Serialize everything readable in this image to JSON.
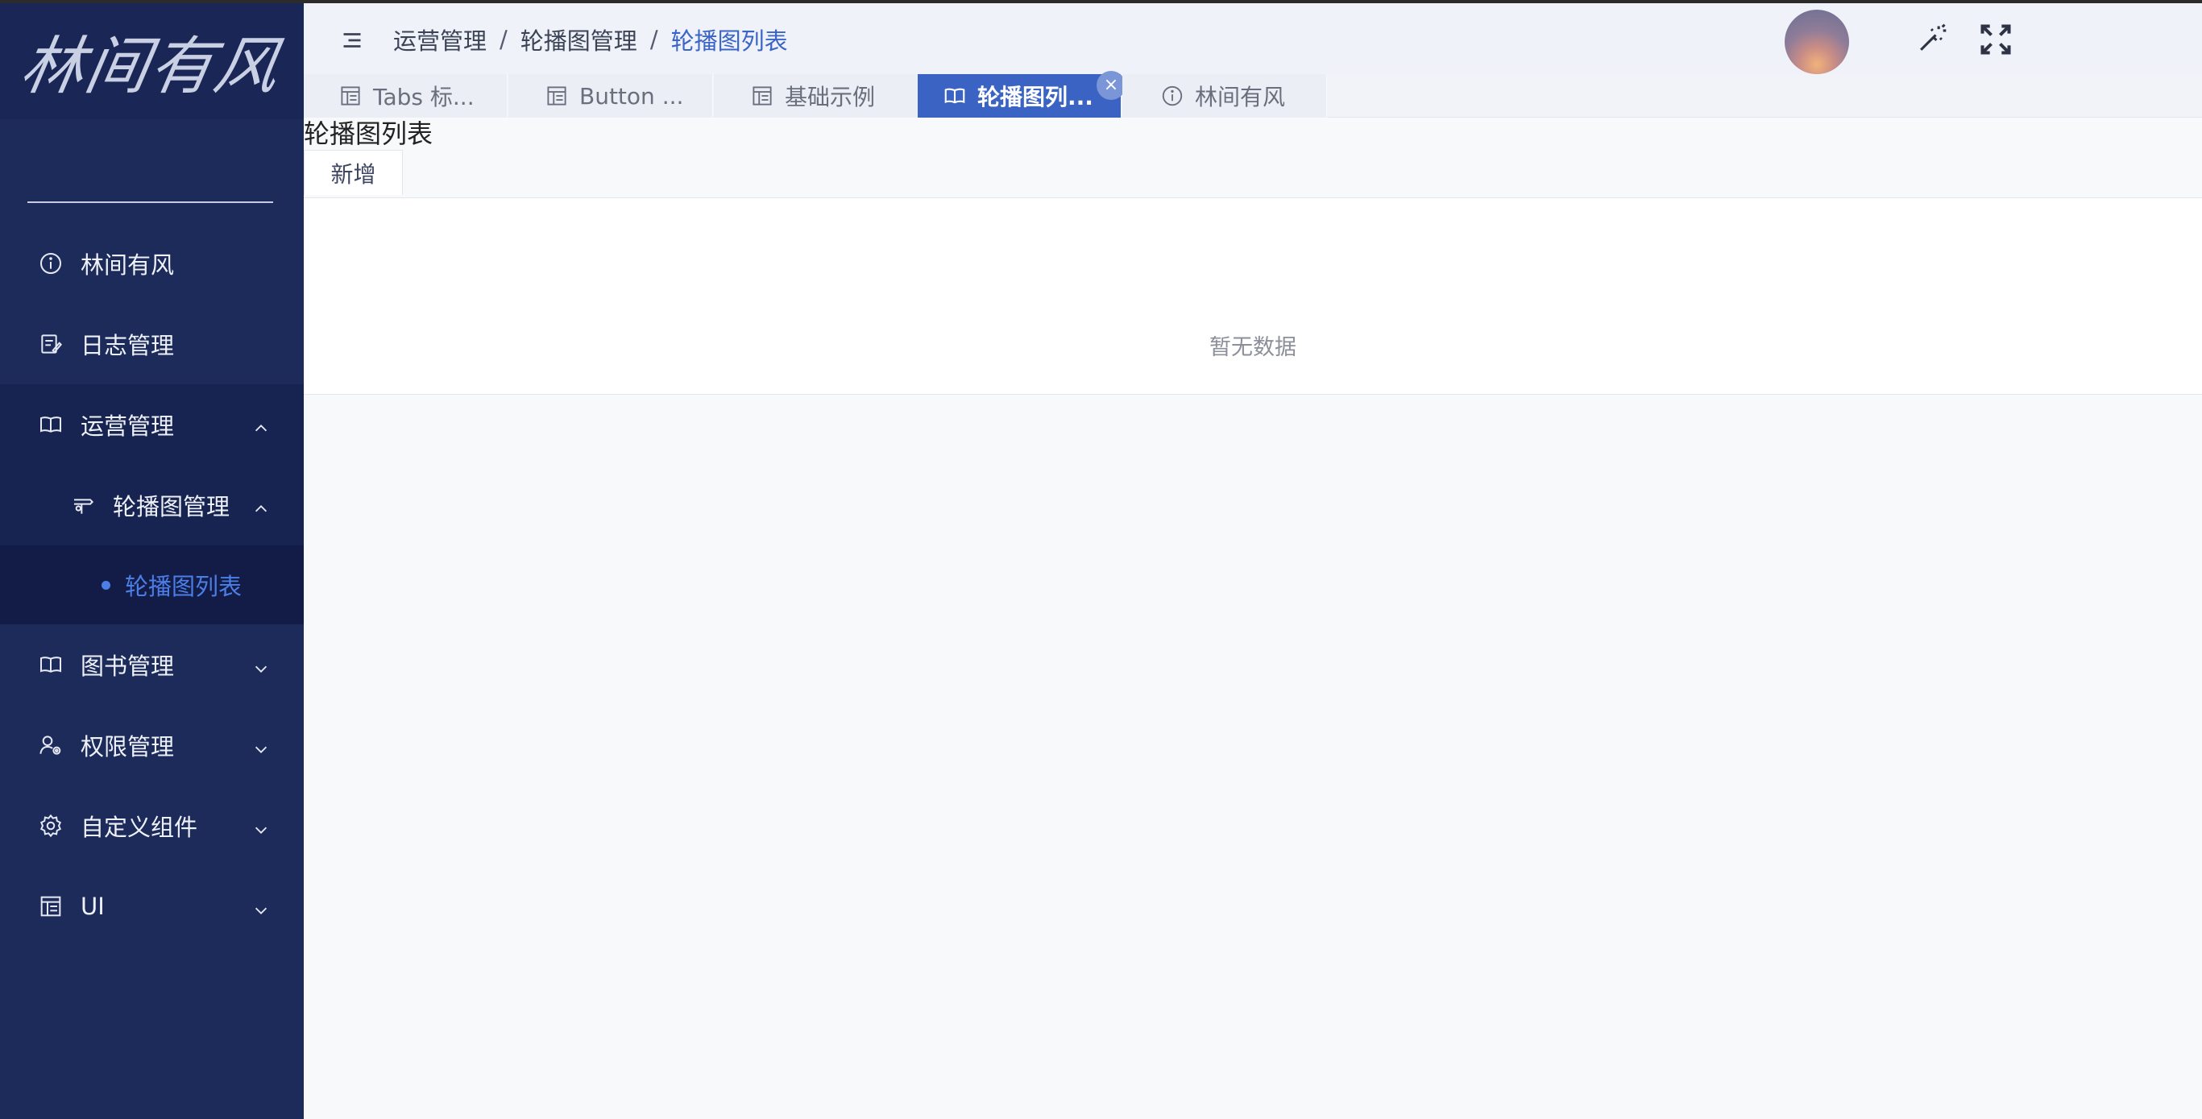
{
  "sidebar": {
    "logo_text": "林间有风",
    "search_placeholder": "",
    "items": [
      {
        "label": "林间有风",
        "icon": "info-circle-icon"
      },
      {
        "label": "日志管理",
        "icon": "edit-note-icon"
      },
      {
        "label": "运营管理",
        "icon": "book-open-icon",
        "expanded": true,
        "children": [
          {
            "label": "轮播图管理",
            "icon": "carousel-icon",
            "expanded": true,
            "children": [
              {
                "label": "轮播图列表",
                "active": true
              }
            ]
          }
        ]
      },
      {
        "label": "图书管理",
        "icon": "book-open-icon"
      },
      {
        "label": "权限管理",
        "icon": "user-settings-icon"
      },
      {
        "label": "自定义组件",
        "icon": "gear-icon"
      },
      {
        "label": "UI",
        "icon": "layout-icon"
      }
    ]
  },
  "header": {
    "breadcrumb": [
      "运营管理",
      "轮播图管理",
      "轮播图列表"
    ],
    "icons": [
      "magic-wand-icon",
      "fullscreen-icon",
      "avatar"
    ]
  },
  "tabs": [
    {
      "label": "Tabs 标...",
      "icon": "layout-icon"
    },
    {
      "label": "Button ...",
      "icon": "layout-icon"
    },
    {
      "label": "基础示例",
      "icon": "layout-icon"
    },
    {
      "label": "轮播图列...",
      "icon": "book-open-icon",
      "active": true,
      "close": "×"
    },
    {
      "label": "林间有风",
      "icon": "info-circle-icon"
    }
  ],
  "content": {
    "page_title": "轮播图列表",
    "add_label": "新增",
    "empty_text": "暂无数据"
  },
  "colors": {
    "sidebar_bg": "#1d2b5b",
    "accent": "#3b63c4",
    "active_link": "#4c7ee8"
  }
}
